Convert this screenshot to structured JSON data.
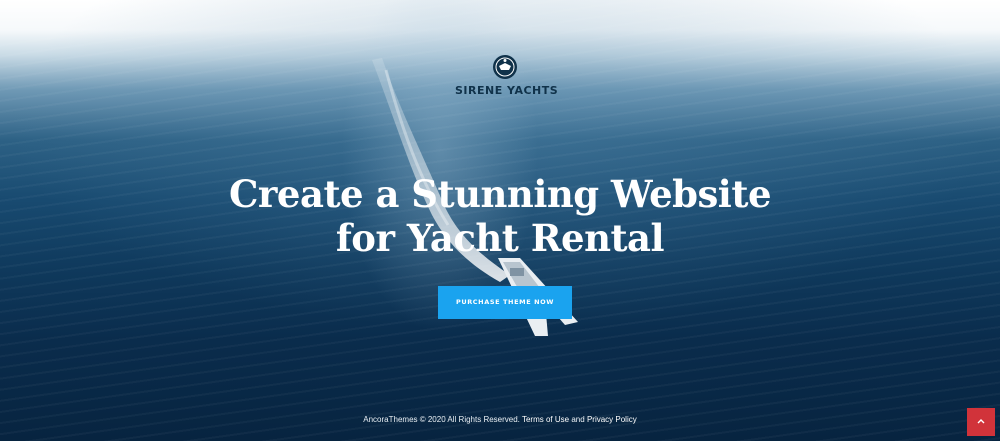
{
  "logo": {
    "name": "SIRENE YACHTS",
    "icon": "anchor-emblem-icon"
  },
  "hero": {
    "headline_line1": "Create a Stunning Website",
    "headline_line2": "for Yacht Rental",
    "cta_label": "PURCHASE THEME NOW"
  },
  "footer": {
    "copyright": "AncoraThemes © 2020 All Rights Reserved.",
    "terms_label": "Terms of Use",
    "and_label": "and",
    "privacy_label": "Privacy Policy"
  },
  "scroll_top": {
    "icon": "chevron-up-icon"
  },
  "colors": {
    "cta": "#1aa3ef",
    "scroll_top": "#d1333a",
    "logo_text": "#10324a"
  }
}
